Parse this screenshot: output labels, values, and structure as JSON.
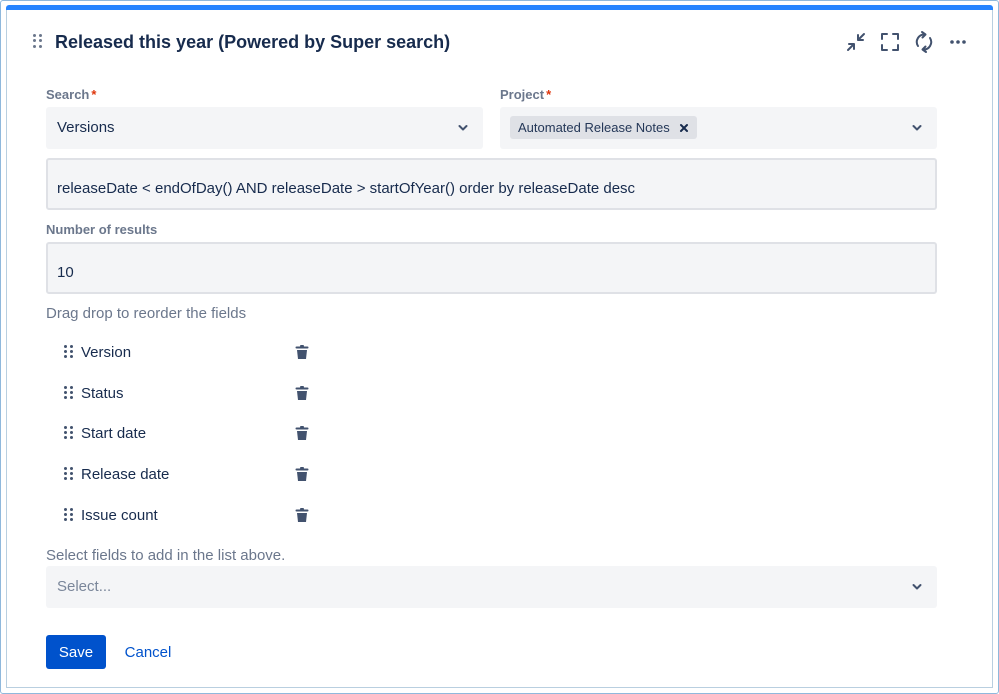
{
  "header": {
    "title": "Released this year (Powered by Super search)",
    "icons": [
      "drag-handle-icon",
      "minimize-icon",
      "fullscreen-icon",
      "refresh-icon",
      "more-icon"
    ]
  },
  "form": {
    "search": {
      "label": "Search",
      "required_mark": "*",
      "value": "Versions"
    },
    "project": {
      "label": "Project",
      "required_mark": "*",
      "selected_tag": "Automated Release Notes"
    },
    "query": {
      "value": "releaseDate < endOfDay() AND releaseDate > startOfYear() order by releaseDate desc"
    },
    "results": {
      "label": "Number of results",
      "value": "10"
    },
    "fields_hint": "Drag drop to reorder the fields",
    "fields": [
      {
        "name": "Version"
      },
      {
        "name": "Status"
      },
      {
        "name": "Start date"
      },
      {
        "name": "Release date"
      },
      {
        "name": "Issue count"
      }
    ],
    "add_fields": {
      "label": "Select fields to add in the list above.",
      "placeholder": "Select..."
    }
  },
  "actions": {
    "save_label": "Save",
    "cancel_label": "Cancel"
  },
  "colors": {
    "accent": "#2684ff",
    "primary_button": "#0052cc",
    "required": "#de350b",
    "field_bg": "#f4f5f7"
  }
}
